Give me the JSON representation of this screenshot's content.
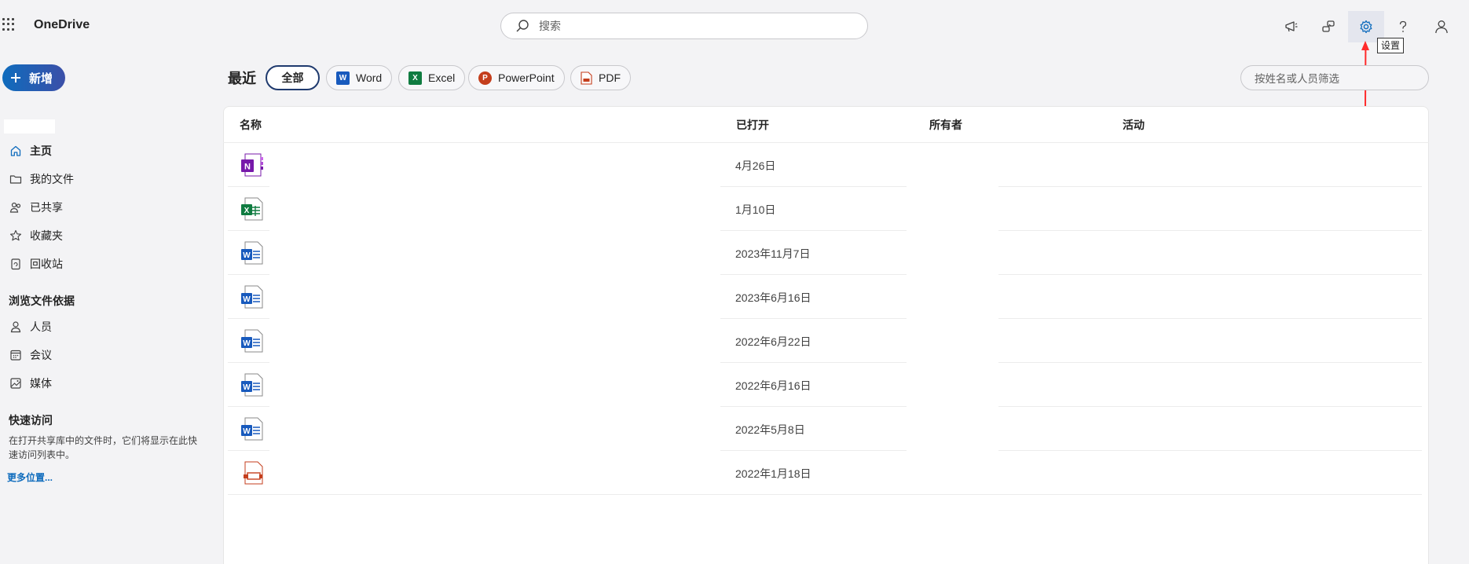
{
  "app": {
    "title": "OneDrive"
  },
  "search": {
    "placeholder": "搜索"
  },
  "header_icons": [
    "megaphone-icon",
    "share-feedback-icon",
    "gear-icon",
    "help-icon",
    "account-icon"
  ],
  "tooltip": {
    "text": "设置"
  },
  "new_button": {
    "label": "新增"
  },
  "nav": {
    "items": [
      {
        "label": "主页",
        "icon": "home-icon",
        "selected": true
      },
      {
        "label": "我的文件",
        "icon": "folder-icon"
      },
      {
        "label": "已共享",
        "icon": "people-icon"
      },
      {
        "label": "收藏夹",
        "icon": "star-icon"
      },
      {
        "label": "回收站",
        "icon": "recycle-bin-icon"
      }
    ],
    "browse_heading": "浏览文件依据",
    "browse_items": [
      {
        "label": "人员",
        "icon": "person-icon"
      },
      {
        "label": "会议",
        "icon": "calendar-icon"
      },
      {
        "label": "媒体",
        "icon": "image-icon"
      }
    ],
    "quick_access_heading": "快速访问",
    "quick_access_desc": "在打开共享库中的文件时，它们将显示在此快速访问列表中。",
    "more_locations": "更多位置..."
  },
  "main": {
    "title": "最近",
    "filters": [
      {
        "label": "全部",
        "selected": true
      },
      {
        "label": "Word",
        "icon": "word-icon"
      },
      {
        "label": "Excel",
        "icon": "excel-icon"
      },
      {
        "label": "PowerPoint",
        "icon": "powerpoint-icon"
      },
      {
        "label": "PDF",
        "icon": "pdf-icon"
      }
    ],
    "filter_placeholder": "按姓名或人员筛选",
    "columns": [
      "名称",
      "已打开",
      "所有者",
      "活动"
    ],
    "rows": [
      {
        "type": "onenote",
        "opened": "4月26日"
      },
      {
        "type": "excel",
        "opened": "1月10日"
      },
      {
        "type": "word",
        "opened": "2023年11月7日"
      },
      {
        "type": "word",
        "opened": "2023年6月16日"
      },
      {
        "type": "word",
        "opened": "2022年6月22日"
      },
      {
        "type": "word",
        "opened": "2022年6月16日"
      },
      {
        "type": "word",
        "opened": "2022年5月8日"
      },
      {
        "type": "pdf",
        "opened": "2022年1月18日"
      }
    ]
  },
  "colors": {
    "accent": "#0f6cbd",
    "annotation": "#ff2b2b"
  }
}
